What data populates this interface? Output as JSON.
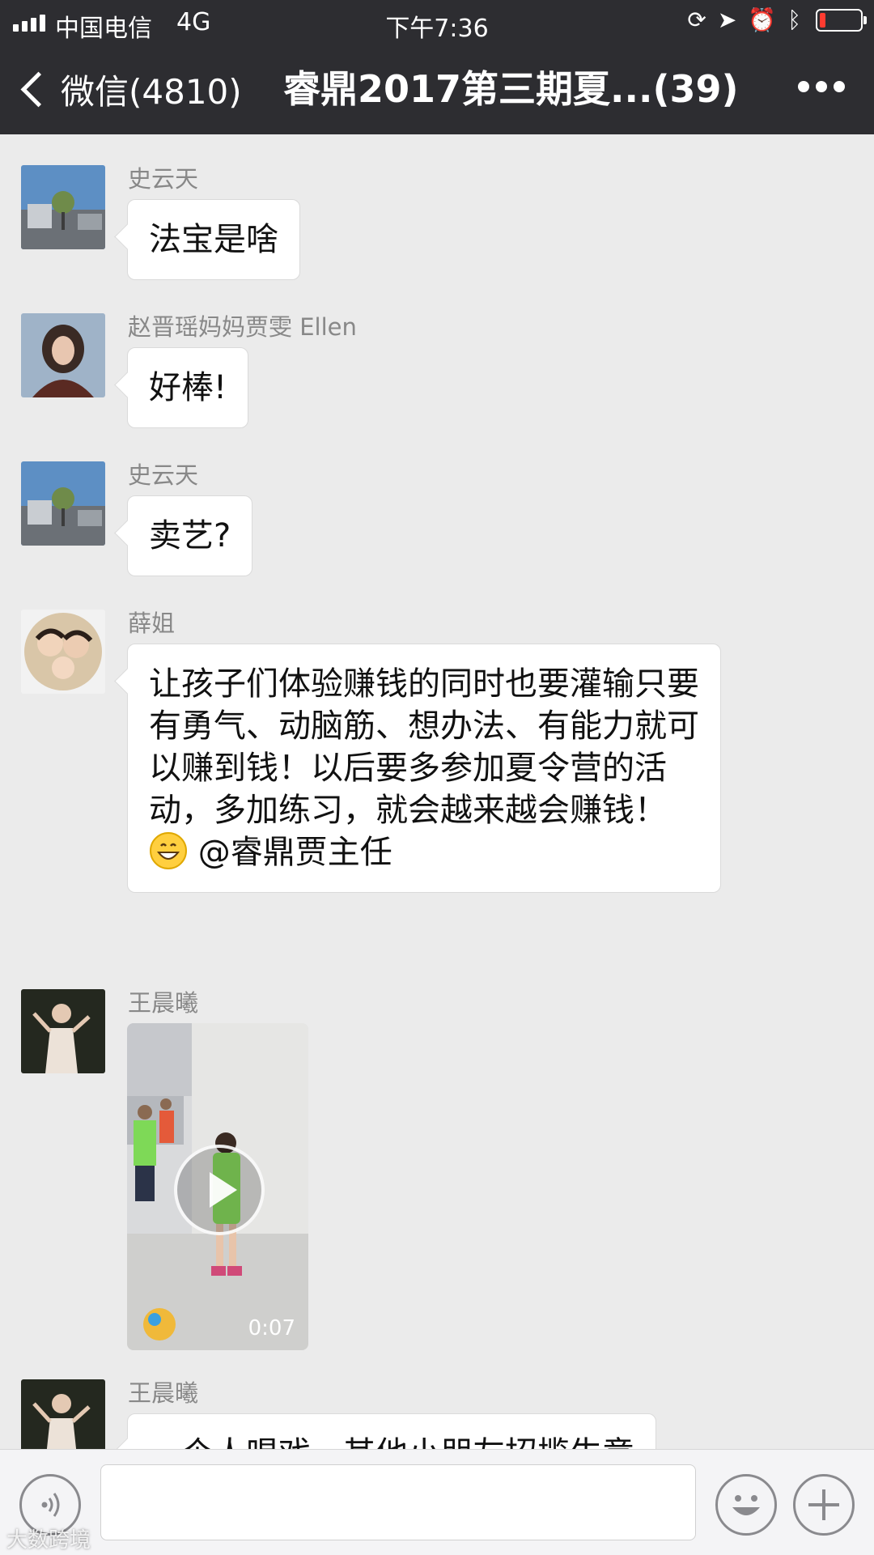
{
  "status_bar": {
    "carrier": "中国电信",
    "network": "4G",
    "time": "下午7:36",
    "battery_level": 0.15,
    "battery_color": "#ff3b30"
  },
  "nav": {
    "back_label": "微信(4810)",
    "title": "睿鼎2017第三期夏...(39)",
    "more_icon": "more-dots-icon"
  },
  "messages": [
    {
      "sender": "史云天",
      "text": "法宝是啥"
    },
    {
      "sender": "赵晋瑶妈妈贾雯 Ellen",
      "text": "好棒!"
    },
    {
      "sender": "史云天",
      "text": "卖艺?"
    },
    {
      "sender": "薛姐",
      "text": "让孩子们体验赚钱的同时也要灌输只要有勇气、动脑筋、想办法、有能力就可以赚到钱！以后要多参加夏令营的活动，多加练习，就会越来越会赚钱！",
      "emoji": "grinning-face-icon",
      "mention": "@睿鼎贾主任"
    },
    {
      "sender": "王晨曦",
      "type": "video",
      "duration": "0:07"
    },
    {
      "sender": "王晨曦",
      "text": "一个人唱戏，其他小朋友招揽生意"
    }
  ],
  "input_bar": {
    "voice_icon": "voice-icon",
    "emoji_icon": "emoji-icon",
    "plus_icon": "plus-icon"
  },
  "watermark": "大数跨境",
  "colors": {
    "nav_bg": "#2d2d31",
    "chat_bg": "#ebebeb",
    "bubble_bg": "#ffffff"
  }
}
